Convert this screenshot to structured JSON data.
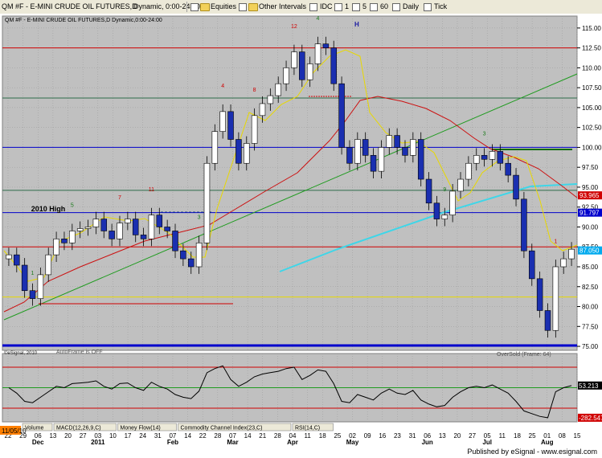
{
  "toolbar": {
    "symbol": "QM #F - E-MINI CRUDE OIL FUTURES,D",
    "mode": "Dynamic, 0:00-24:00",
    "equities": "Equities",
    "other_intervals": "Other Intervals",
    "idc": "IDC",
    "intervals": [
      "1",
      "5",
      "60",
      "Daily",
      "Tick"
    ]
  },
  "chart_data": [
    {
      "type": "candlestick",
      "title": "QM #F - E-MINI CRUDE OIL FUTURES,D Dynamic,0:00-24:00",
      "ylim": [
        74.5,
        116.5
      ],
      "y_ticks": [
        75.0,
        77.5,
        80.0,
        82.5,
        85.0,
        87.5,
        90.0,
        92.5,
        95.0,
        97.5,
        100.0,
        102.5,
        105.0,
        107.5,
        110.0,
        112.5,
        115.0
      ],
      "price_labels": [
        {
          "text": "93.965",
          "value": 93.97,
          "color": "#d00000"
        },
        {
          "text": "91.797",
          "value": 91.8,
          "color": "#0000cc"
        },
        {
          "text": "87.050",
          "value": 87.05,
          "color": "#00aaee"
        }
      ],
      "horizontal_lines": [
        {
          "value": 112.5,
          "color": "#d00000"
        },
        {
          "value": 106.2,
          "color": "#2e6b4a"
        },
        {
          "value": 100.0,
          "color": "#0000cc"
        },
        {
          "value": 94.6,
          "color": "#2e6b4a"
        },
        {
          "value": 91.8,
          "color": "#0000cc"
        },
        {
          "value": 87.5,
          "color": "#d00000"
        },
        {
          "value": 81.2,
          "color": "#e8d800"
        },
        {
          "value": 75.1,
          "color": "#0000cc"
        }
      ],
      "annotations": [
        "2010 High",
        "H",
        "AutoFrame is OFF",
        "OverSold (Frame: 64)",
        "©eSignal, 2010"
      ],
      "x_ticks": [
        "22",
        "29",
        "06",
        "13",
        "20",
        "27",
        "03",
        "10",
        "17",
        "24",
        "31",
        "07",
        "14",
        "22",
        "28",
        "07",
        "14",
        "21",
        "28",
        "04",
        "11",
        "18",
        "25",
        "02",
        "09",
        "16",
        "23",
        "31",
        "06",
        "13",
        "20",
        "27",
        "05",
        "11",
        "18",
        "25",
        "01",
        "08",
        "15"
      ],
      "months": [
        {
          "label": "Dec",
          "index": 2
        },
        {
          "label": "2011",
          "index": 6
        },
        {
          "label": "Feb",
          "index": 11
        },
        {
          "label": "Mar",
          "index": 15
        },
        {
          "label": "Apr",
          "index": 19
        },
        {
          "label": "May",
          "index": 23
        },
        {
          "label": "Jun",
          "index": 28
        },
        {
          "label": "Jul",
          "index": 32
        },
        {
          "label": "Aug",
          "index": 36
        }
      ],
      "date_badge": "11/05/10",
      "closes": [
        86.5,
        85.2,
        82.0,
        81.0,
        84.0,
        86.5,
        88.5,
        88.0,
        89.5,
        89.8,
        90.0,
        91.0,
        89.5,
        88.5,
        90.5,
        91.0,
        89.0,
        88.5,
        91.5,
        90.0,
        89.5,
        87.0,
        86.0,
        85.0,
        88.0,
        98.0,
        102.0,
        104.5,
        101.0,
        98.0,
        100.5,
        104.0,
        105.5,
        106.5,
        108.0,
        110.0,
        112.0,
        108.5,
        110.5,
        113.0,
        112.5,
        108.0,
        100.0,
        98.0,
        101.0,
        99.0,
        97.0,
        100.0,
        101.5,
        100.0,
        99.0,
        101.0,
        96.0,
        93.0,
        91.0,
        91.5,
        94.5,
        96.0,
        98.0,
        99.0,
        98.5,
        99.5,
        98.0,
        96.5,
        93.5,
        87.0,
        83.5,
        79.5,
        77.0,
        85.0,
        86.0,
        87.2
      ]
    },
    {
      "type": "line",
      "indicator": "RSI(14,C)",
      "ylim": [
        0,
        100
      ],
      "levels": [
        80,
        50,
        20
      ],
      "value_labels": [
        {
          "text": "53.213",
          "value": 53.2
        },
        {
          "text": "-282.547",
          "value": 6.0
        }
      ],
      "values": [
        50,
        42,
        30,
        28,
        36,
        44,
        52,
        50,
        56,
        57,
        58,
        60,
        52,
        48,
        56,
        57,
        50,
        46,
        58,
        52,
        48,
        40,
        36,
        34,
        45,
        72,
        78,
        82,
        62,
        52,
        58,
        66,
        70,
        72,
        74,
        78,
        80,
        62,
        68,
        76,
        74,
        56,
        30,
        28,
        40,
        36,
        32,
        42,
        48,
        42,
        40,
        46,
        32,
        26,
        22,
        24,
        36,
        44,
        50,
        52,
        50,
        54,
        48,
        42,
        30,
        16,
        12,
        8,
        6,
        44,
        50,
        53
      ]
    }
  ],
  "tabs": [
    "Volume",
    "MACD(12,26,9,C)",
    "Money Flow(14)",
    "Commodity Channel Index(23,C)",
    "RSI(14,C)"
  ],
  "footer": {
    "text": "Published by eSignal - www.esignal.com"
  }
}
